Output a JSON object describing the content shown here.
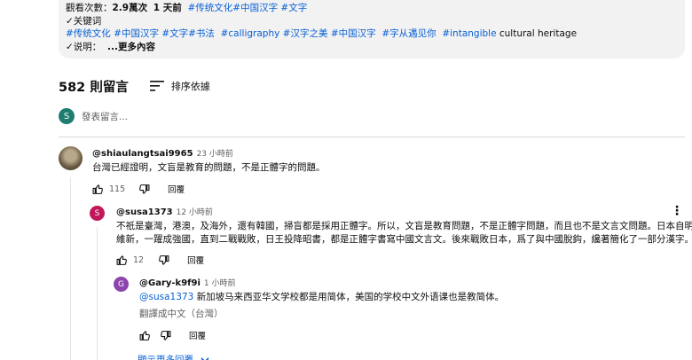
{
  "description": {
    "views_label": "觀看次數：",
    "views_value": "2.9萬次",
    "date": "1 天前",
    "header_tags": [
      "#传统文化",
      "#中国汉字",
      "#文字"
    ],
    "keywords_label": "✓关键词",
    "tags": [
      "#传统文化",
      "#中国汉字",
      "#文字#书法",
      "#calligraphy",
      "#汉字之美",
      "#中国汉字",
      "#字从遇见你",
      "#intangible"
    ],
    "tags_tail": "cultural heritage",
    "note_label": "✓说明：",
    "more_label": "...更多內容"
  },
  "comments_header": {
    "count": "582 則留言",
    "sort_label": "排序依據"
  },
  "add_comment": {
    "avatar_letter": "S",
    "placeholder": "發表留言..."
  },
  "comments": [
    {
      "author": "@shiaulangtsai9965",
      "time": "23 小時前",
      "text": "台灣已經證明，文盲是教育的問題，不是正體字的問題。",
      "likes": "115",
      "reply_label": "回覆"
    },
    {
      "avatar_letter": "S",
      "author": "@susa1373",
      "time": "12 小時前",
      "text_line1": "不祇是臺灣，港澳，及海外，還有韓國，掃盲都是採用正體字。所以，文盲是教育問題，不是正體字問題，而且也不是文言文問題。日本自明治",
      "text_line2": "維新，一躍成強國，直到二戰戰敗，日王投降昭書，都是正體字書寫中國文言文。後來戰敗日本，爲了與中國脫鈎，纔著簡化了一部分漢字。",
      "likes": "12",
      "reply_label": "回覆"
    },
    {
      "avatar_letter": "G",
      "author": "@Gary-k9f9i",
      "time": "1 小時前",
      "mention": "@susa1373",
      "text": " 新加坡马来西亚华文学校都是用简体，美国的学校中文外语课也是教简体。",
      "translate_label": "翻譯成中文（台灣）",
      "reply_label": "回覆"
    }
  ],
  "more_replies_label": "顯示更多回覆",
  "colors": {
    "link": "#065fd4",
    "avatar_s": "#1e7d6f",
    "avatar_s_pink": "#c2185b",
    "avatar_g": "#8e44ad"
  }
}
